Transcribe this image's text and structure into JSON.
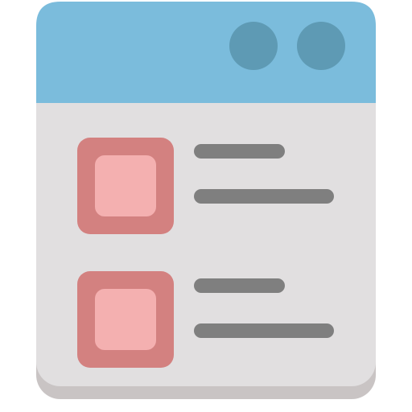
{
  "icon": {
    "name": "checklist-window-icon",
    "colors": {
      "window_body": "#e1dfe0",
      "window_bottom_shadow": "#c9c4c4",
      "title_bar": "#7bbcdc",
      "title_bar_dots": "#5e9ab4",
      "checkbox_outer": "#d38180",
      "checkbox_inner": "#f4b0b0",
      "text_lines": "#7f7f7f"
    },
    "title_bar_dots_count": 2,
    "list_items": [
      {
        "name": "list-item-1",
        "line_count": 2
      },
      {
        "name": "list-item-2",
        "line_count": 2
      }
    ]
  }
}
